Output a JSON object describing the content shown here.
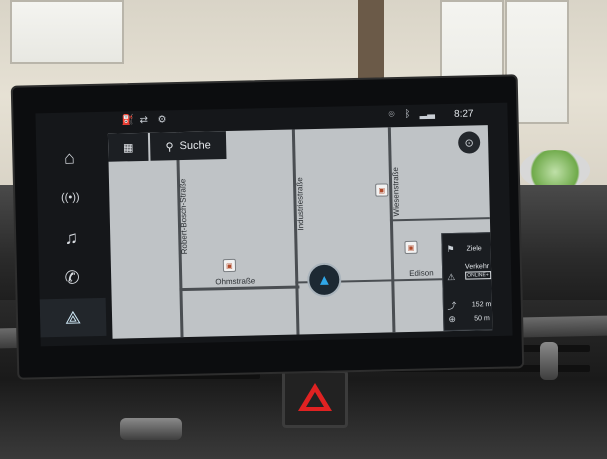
{
  "status_bar": {
    "icons": [
      "fuel-icon",
      "car-sync-icon",
      "service-icon",
      "location-icon",
      "bluetooth-icon",
      "signal-icon"
    ],
    "time": "8:27"
  },
  "sidebar": {
    "items": [
      {
        "name": "home",
        "icon": "⌂"
      },
      {
        "name": "radio",
        "icon": "((•))"
      },
      {
        "name": "music",
        "icon": "♫"
      },
      {
        "name": "phone",
        "icon": "✆"
      },
      {
        "name": "navigation",
        "icon": "⟁",
        "active": true
      }
    ]
  },
  "map": {
    "toolbar": {
      "menu_icon": "▦",
      "search_icon": "⚲",
      "search_label": "Suche"
    },
    "streets": [
      {
        "name": "Robert-Bosch-Straße"
      },
      {
        "name": "Industriestraße"
      },
      {
        "name": "Wiesenstraße"
      },
      {
        "name": "Ohmstraße"
      },
      {
        "name": "Edison"
      }
    ],
    "compass_icon": "⊙"
  },
  "nav_panel": {
    "destination_label": "Ziele",
    "traffic_label": "Verkehr",
    "traffic_badge": "ONLINE+",
    "distance_1": "152 m",
    "distance_2": "50 m"
  },
  "colors": {
    "map_bg": "#bfc3c6",
    "accent_blue": "#30a7e8",
    "hazard_red": "#e02222"
  }
}
